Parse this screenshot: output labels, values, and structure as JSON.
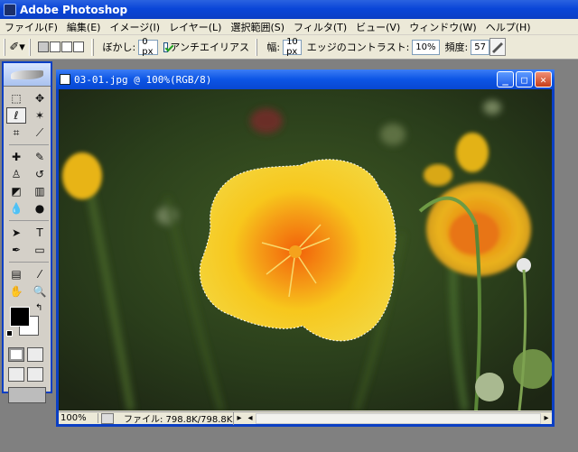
{
  "app": {
    "title": "Adobe Photoshop"
  },
  "menu": [
    "ファイル(F)",
    "編集(E)",
    "イメージ(I)",
    "レイヤー(L)",
    "選択範囲(S)",
    "フィルタ(T)",
    "ビュー(V)",
    "ウィンドウ(W)",
    "ヘルプ(H)"
  ],
  "options": {
    "feather_label": "ぼかし:",
    "feather_value": "0 px",
    "antialias_label": "アンチエイリアス",
    "width_label": "幅:",
    "width_value": "10 px",
    "contrast_label": "エッジのコントラスト:",
    "contrast_value": "10%",
    "frequency_label": "頻度:",
    "frequency_value": "57"
  },
  "document": {
    "title": "03-01.jpg @ 100%(RGB/8)",
    "zoom": "100%",
    "file_info": "ファイル: 798.8K/798.8K"
  },
  "colors": {
    "accent": "#0b3fc4",
    "flower": "#f5c21a",
    "flower_center": "#f07a10",
    "background": "#2b3a1f"
  }
}
